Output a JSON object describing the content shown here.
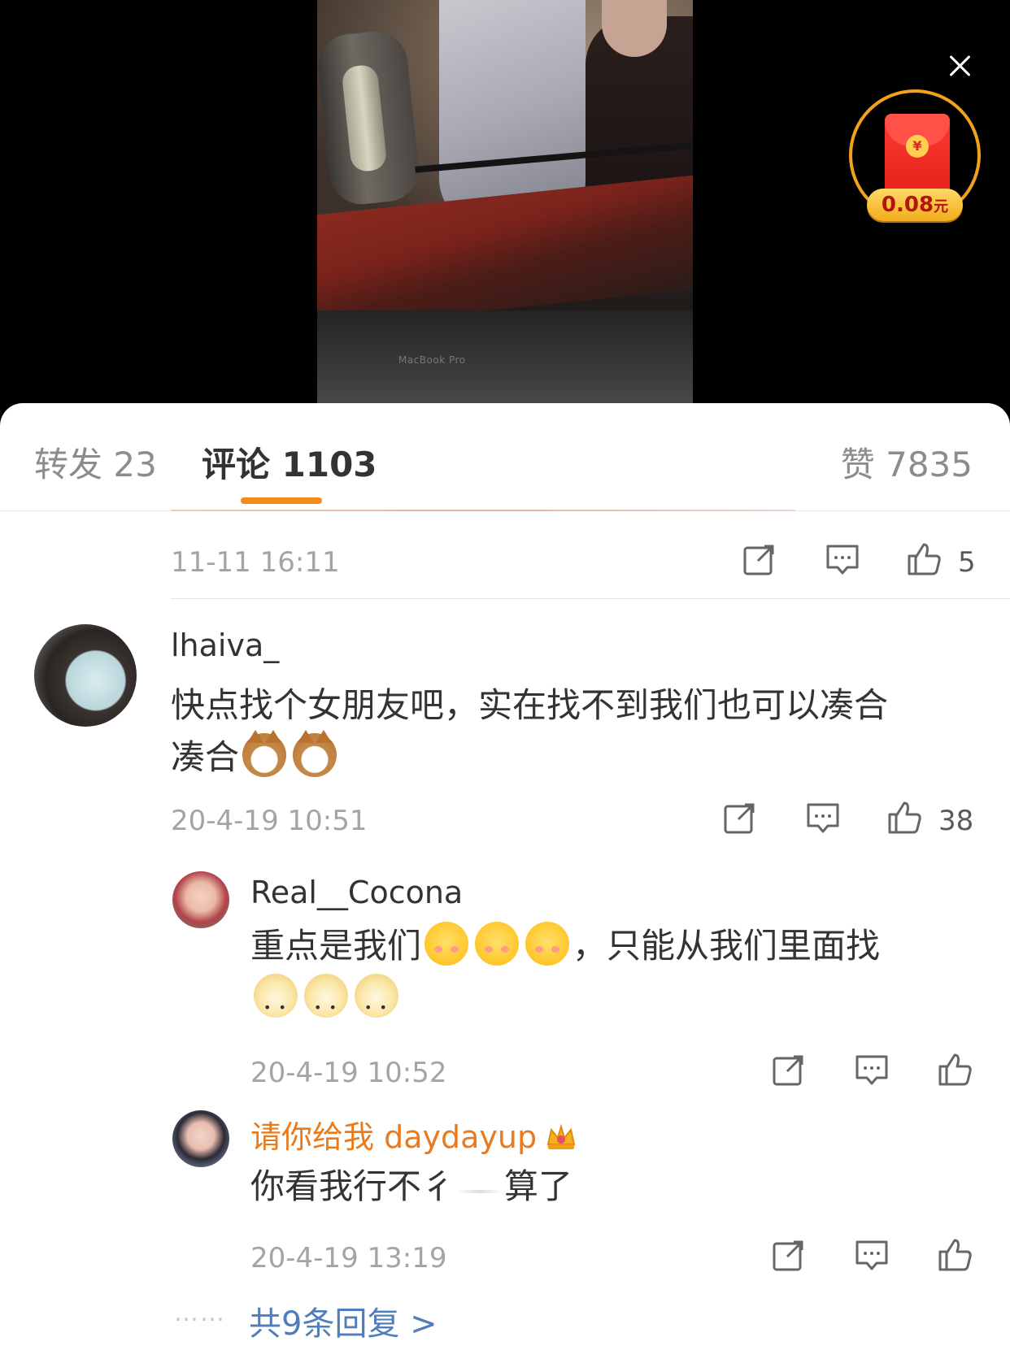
{
  "video": {
    "brand_text": "MacBook Pro",
    "red_packet_amount": "0.08",
    "red_packet_unit": "元",
    "red_packet_coin": "¥"
  },
  "tabs": {
    "forward": "转发 23",
    "comments": "评论 1103",
    "likes": "赞 7835"
  },
  "top_comment_tail": {
    "time": "11-11 16:11",
    "like_count": "5"
  },
  "comment": {
    "username": "lhaiva_",
    "text_line1": "快点找个女朋友吧，实在找不到我们也可以凑合",
    "text_line2": "凑合",
    "time": "20-4-19 10:51",
    "like_count": "38"
  },
  "replies": [
    {
      "username": "Real__Cocona",
      "text_a": "重点是我们",
      "text_b": "，只能从我们里面找",
      "time": "20-4-19 10:52"
    },
    {
      "username": "请你给我 daydayup",
      "text_a": "你看我行不彳",
      "text_b": "算了",
      "time": "20-4-19 13:19"
    }
  ],
  "more": {
    "dots": "……",
    "label": "共9条回复 >"
  },
  "icons": [
    "close-icon",
    "red-packet-icon",
    "share-icon",
    "reply-icon",
    "like-icon",
    "crown-badge-icon"
  ],
  "colors": {
    "accent": "#f28c1a",
    "link": "#4f7eb8",
    "vip_name": "#eb7a1c"
  }
}
